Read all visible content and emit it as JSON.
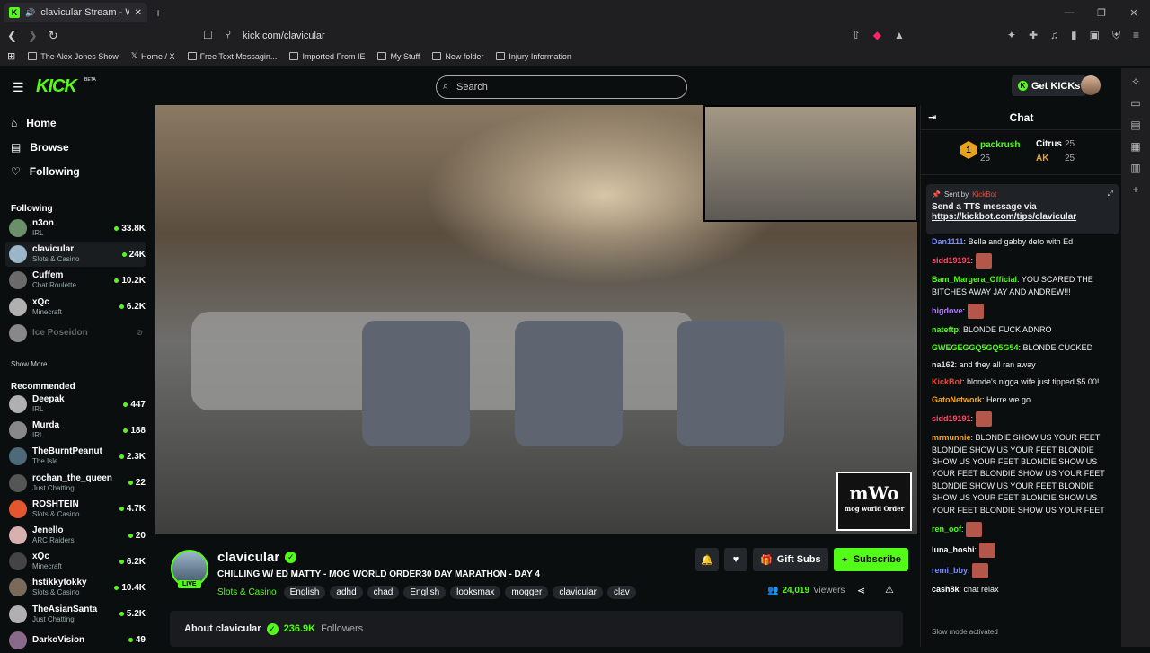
{
  "browser": {
    "tab_title": "clavicular Stream - Watch Live",
    "tab_icon": "kick-favicon",
    "new_tab": "+",
    "url": "kick.com/clavicular",
    "win_min": "—",
    "win_max": "❐",
    "win_close": "✕",
    "bookmarks": [
      {
        "label": "The Alex Jones Show"
      },
      {
        "label": "Home / X"
      },
      {
        "label": "Free Text Messagin..."
      },
      {
        "label": "Imported From IE"
      },
      {
        "label": "My Stuff"
      },
      {
        "label": "New folder"
      },
      {
        "label": "Injury Information"
      }
    ]
  },
  "header": {
    "logo": "KICK",
    "beta": "BETA",
    "search_placeholder": "Search",
    "get_kicks": "Get KICKs"
  },
  "sidebar": {
    "nav": [
      {
        "label": "Home"
      },
      {
        "label": "Browse"
      },
      {
        "label": "Following"
      }
    ],
    "following_title": "Following",
    "following": [
      {
        "name": "n3on",
        "game": "IRL",
        "viewers": "33.8K"
      },
      {
        "name": "clavicular",
        "game": "Slots & Casino",
        "viewers": "24K"
      },
      {
        "name": "Cuffem",
        "game": "Chat Roulette",
        "viewers": "10.2K"
      },
      {
        "name": "xQc",
        "game": "Minecraft",
        "viewers": "6.2K"
      },
      {
        "name": "Ice Poseidon",
        "game": "",
        "viewers": ""
      }
    ],
    "show_more": "Show More",
    "recommended_title": "Recommended",
    "recommended": [
      {
        "name": "Deepak",
        "game": "IRL",
        "viewers": "447"
      },
      {
        "name": "Murda",
        "game": "IRL",
        "viewers": "188"
      },
      {
        "name": "TheBurntPeanut",
        "game": "The Isle",
        "viewers": "2.3K"
      },
      {
        "name": "rochan_the_queen",
        "game": "Just Chatting",
        "viewers": "22"
      },
      {
        "name": "ROSHTEIN",
        "game": "Slots & Casino",
        "viewers": "4.7K"
      },
      {
        "name": "Jenello",
        "game": "ARC Raiders",
        "viewers": "20"
      },
      {
        "name": "xQc",
        "game": "Minecraft",
        "viewers": "6.2K"
      },
      {
        "name": "hstikkytokky",
        "game": "Slots & Casino",
        "viewers": "10.4K"
      },
      {
        "name": "TheAsianSanta",
        "game": "Just Chatting",
        "viewers": "5.2K"
      },
      {
        "name": "DarkoVision",
        "game": "",
        "viewers": "49"
      }
    ]
  },
  "video": {
    "overlay_logo": "mWo",
    "overlay_sub": "mog world Order"
  },
  "stream": {
    "name": "clavicular",
    "live": "LIVE",
    "title": "CHILLING W/ ED MATTY - MOG WORLD ORDER30 DAY MARATHON - DAY 4",
    "category": "Slots & Casino",
    "tags": [
      "English",
      "adhd",
      "chad",
      "English",
      "looksmax",
      "mogger",
      "clavicular",
      "clav"
    ],
    "viewers": "24,019",
    "viewers_label": "Viewers",
    "gift_subs": "Gift Subs",
    "subscribe": "Subscribe",
    "about_label": "About clavicular",
    "followers": "236.9K",
    "followers_label": "Followers"
  },
  "chat": {
    "title": "Chat",
    "gifters": {
      "first": {
        "rank": "1",
        "name": "packrush",
        "count": "25"
      },
      "second": {
        "name": "Citrus",
        "count": "25"
      },
      "third": {
        "name": "AK",
        "count": "25"
      }
    },
    "pinned": {
      "sent_by": "Sent by",
      "bot": "KickBot",
      "line1": "Send a TTS message via",
      "link": "https://kickbot.com/tips/clavicular"
    },
    "messages": [
      {
        "user": "Dan1111",
        "color": "#7b8cff",
        "text": "Bella and gabby defo with Ed"
      },
      {
        "user": "sidd19191",
        "color": "#ff4d6d",
        "text": ""
      },
      {
        "user": "Bam_Margera_Official",
        "color": "#53fc18",
        "text": "YOU SCARED THE BITCHES AWAY JAY AND ANDREW!!!"
      },
      {
        "user": "bigdove",
        "color": "#b37bff",
        "text": ""
      },
      {
        "user": "nateftp",
        "color": "#53fc18",
        "text": "BLONDE FUCK ADNRO"
      },
      {
        "user": "GWEGEGGQ5GQ5G54",
        "color": "#53fc18",
        "text": "BLONDE CUCKED"
      },
      {
        "user": "na162",
        "color": "#dcdcdc",
        "text": "and they all ran away"
      },
      {
        "user": "KickBot",
        "color": "#e74c3c",
        "text": "blonde's nigga wife just tipped $5.00!"
      },
      {
        "user": "GatoNetwork",
        "color": "#f5a623",
        "text": "Herre we go"
      },
      {
        "user": "sidd19191",
        "color": "#ff4d6d",
        "text": ""
      },
      {
        "user": "mrmunnie",
        "color": "#f5a623",
        "text": "BLONDIE SHOW US YOUR FEET BLONDIE SHOW US YOUR FEET BLONDIE SHOW US YOUR FEET BLONDIE SHOW US YOUR FEET BLONDIE SHOW US YOUR FEET BLONDIE SHOW US YOUR FEET BLONDIE SHOW US YOUR FEET BLONDIE SHOW US YOUR FEET BLONDIE SHOW US YOUR FEET"
      },
      {
        "user": "ren_oof",
        "color": "#53fc18",
        "text": ""
      },
      {
        "user": "luna_hoshi",
        "color": "#ffffff",
        "text": ""
      },
      {
        "user": "remi_bby",
        "color": "#7b8cff",
        "text": ""
      },
      {
        "user": "cash8k",
        "color": "#ffffff",
        "text": "chat relax"
      }
    ],
    "slow_mode": "Slow mode activated"
  }
}
